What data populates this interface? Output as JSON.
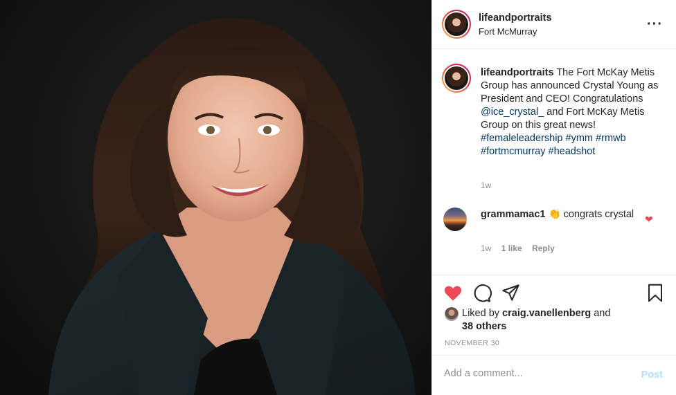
{
  "post": {
    "username": "lifeandportraits",
    "location": "Fort McMurray",
    "caption": {
      "username": "lifeandportraits",
      "text_1": " The Fort McKay Metis Group has announced Crystal Young as President and CEO! Congratulations ",
      "mention": "@ice_crystal_",
      "text_2": " and Fort McKay Metis Group on this great news! ",
      "tag_1": "#femaleleadership",
      "tag_2": "#ymm",
      "tag_3": "#rmwb",
      "tag_4": "#fortmcmurray",
      "tag_5": "#headshot",
      "time": "1w"
    },
    "comment": {
      "username": "grammamac1",
      "emoji": "👏",
      "text": " congrats crystal",
      "time": "1w",
      "likes": "1 like",
      "reply": "Reply"
    },
    "likes": {
      "prefix": "Liked by ",
      "user": "craig.vanellenberg",
      "middle": " and",
      "others": "38 others"
    },
    "date": "NOVEMBER 30",
    "add_comment_placeholder": "Add a comment...",
    "post_label": "Post",
    "more_icon": "···"
  },
  "colors": {
    "like_red": "#ed4956",
    "link_blue": "#00376b",
    "post_disabled": "#b2dffc",
    "muted": "#8e8e8e"
  },
  "icons": [
    "heart-filled-icon",
    "comment-icon",
    "share-icon",
    "bookmark-icon",
    "more-icon"
  ]
}
